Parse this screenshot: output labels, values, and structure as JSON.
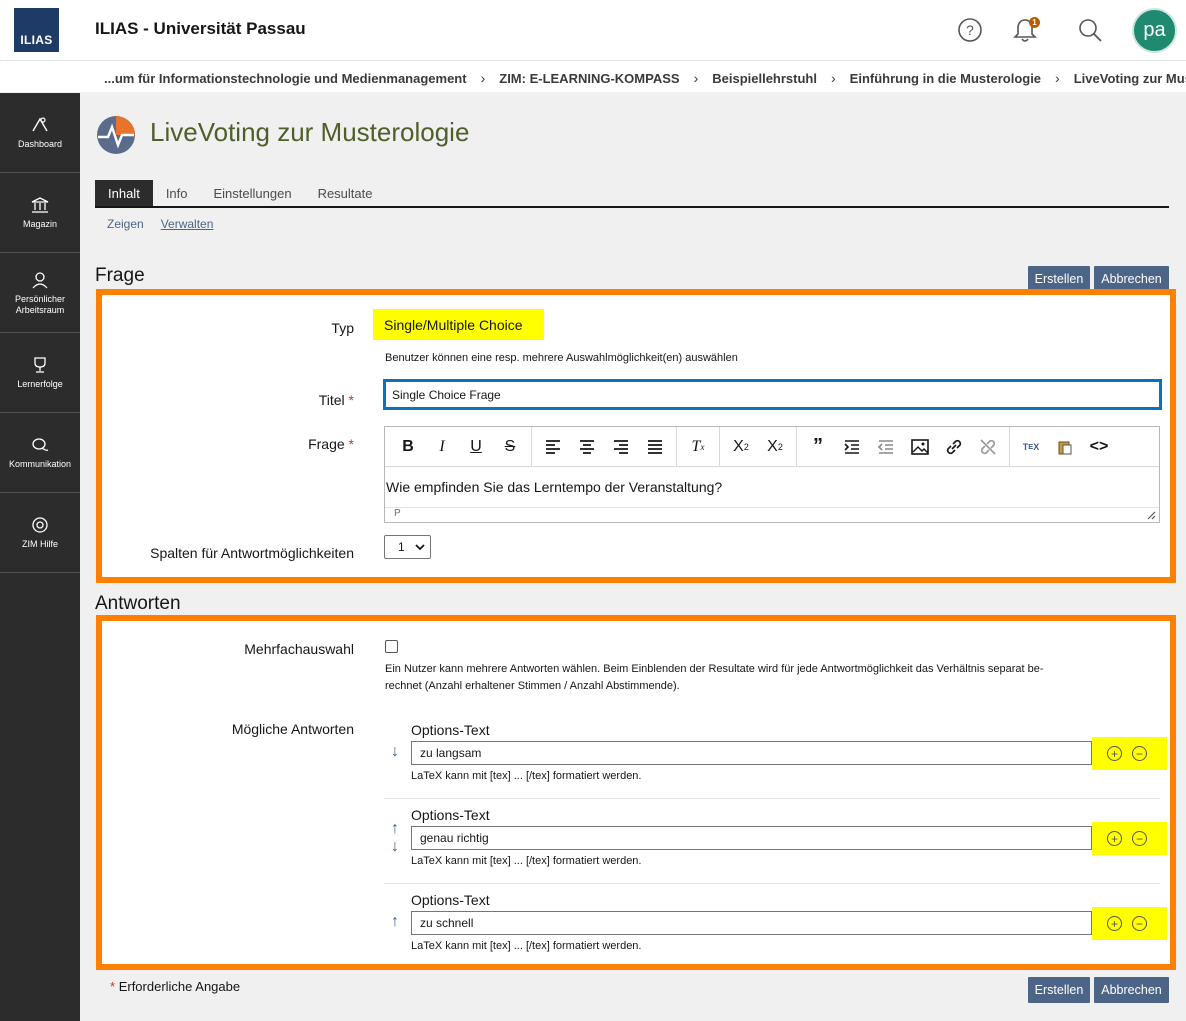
{
  "header": {
    "logo_text": "ILIAS",
    "app_title": "ILIAS - Universität Passau",
    "notification_count": "1",
    "avatar_initials": "pa"
  },
  "breadcrumb": [
    "...um für Informationstechnologie und Medienmanagement",
    "ZIM: E-LEARNING-KOMPASS",
    "Beispiellehrstuhl",
    "Einführung in die Musterologie",
    "LiveVoting zur Musterologie"
  ],
  "sidebar": {
    "items": [
      {
        "label": "Dashboard",
        "icon": "dashboard-icon"
      },
      {
        "label": "Magazin",
        "icon": "bank-icon"
      },
      {
        "label": "Persönlicher Arbeitsraum",
        "icon": "person-icon"
      },
      {
        "label": "Lernerfolge",
        "icon": "trophy-icon"
      },
      {
        "label": "Kommunikation",
        "icon": "chat-icon"
      },
      {
        "label": "ZIM Hilfe",
        "icon": "lifebuoy-icon"
      }
    ]
  },
  "page": {
    "title": "LiveVoting zur Musterologie",
    "tabs": [
      "Inhalt",
      "Info",
      "Einstellungen",
      "Resultate"
    ],
    "subtabs": [
      "Zeigen",
      "Verwalten"
    ]
  },
  "buttons": {
    "create": "Erstellen",
    "cancel": "Abbrechen"
  },
  "frage": {
    "section_title": "Frage",
    "typ_label": "Typ",
    "typ_value": "Single/Multiple Choice",
    "typ_help": "Benutzer können eine resp. mehrere Auswahlmöglichkeit(en) auswählen",
    "titel_label": "Titel",
    "titel_value": "Single Choice Frage",
    "frage_label": "Frage",
    "frage_value": "Wie empfinden Sie das Lerntempo der Veranstaltung?",
    "editor_status": "P",
    "spalten_label": "Spalten für Antwortmöglichkeiten",
    "spalten_value": "1"
  },
  "required_mark": "*",
  "antworten": {
    "section_title": "Antworten",
    "mehrfach_label": "Mehrfachauswahl",
    "mehrfach_help": "Ein Nutzer kann mehrere Antworten wählen. Beim Einblenden der Resultate wird für jede Antwortmöglichkeit das Verhältnis separat be-rechnet (Anzahl erhaltener Stimmen / Anzahl Abstimmende).",
    "mehrfach_help_line1": "Ein Nutzer kann mehrere Antworten wählen. Beim Einblenden der Resultate wird für jede Antwortmöglichkeit das Verhältnis separat be-",
    "mehrfach_help_line2": "rechnet (Anzahl erhaltener Stimmen / Anzahl Abstimmende).",
    "moegliche_label": "Mögliche Antworten",
    "options": [
      {
        "label": "Options-Text",
        "value": "zu langsam",
        "help": "LaTeX kann mit [tex] ... [/tex] formatiert werden."
      },
      {
        "label": "Options-Text",
        "value": "genau richtig",
        "help": "LaTeX kann mit [tex] ... [/tex] formatiert werden."
      },
      {
        "label": "Options-Text",
        "value": "zu schnell",
        "help": "LaTeX kann mit [tex] ... [/tex] formatiert werden."
      }
    ]
  },
  "footnote": "Erforderliche Angabe",
  "colors": {
    "highlight_border": "#ff8000",
    "highlight_fill": "#ffff00",
    "button": "#4c6586",
    "sidebar": "#2c2c2c"
  }
}
